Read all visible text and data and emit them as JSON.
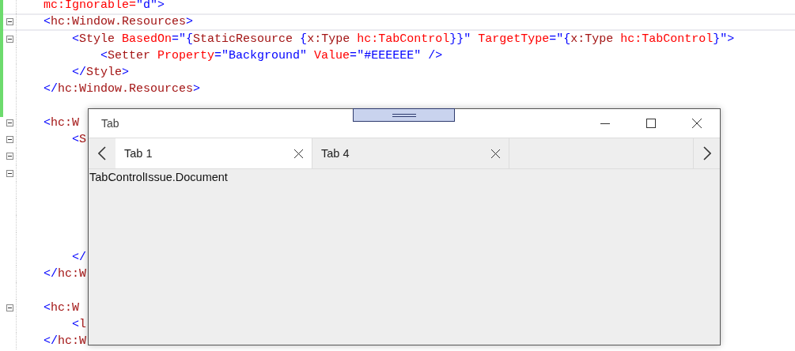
{
  "editor": {
    "lines": [
      {
        "collapsible": false,
        "kind": "outer",
        "tokens": [
          {
            "kind": "attribute",
            "text": "mc:Ignorable="
          },
          {
            "kind": "value",
            "text": "\"d\""
          },
          {
            "kind": "bracket",
            "text": ">"
          }
        ]
      },
      {
        "collapsible": true,
        "kind": "outer",
        "tokens": [
          {
            "kind": "bracket",
            "text": "<"
          },
          {
            "kind": "element",
            "text": "hc:Window.Resources"
          },
          {
            "kind": "bracket",
            "text": ">"
          }
        ]
      },
      {
        "collapsible": true,
        "kind": "inner",
        "tokens": [
          {
            "kind": "bracket",
            "text": "<"
          },
          {
            "kind": "element",
            "text": "Style"
          },
          {
            "kind": "attribute",
            "text": " BasedOn"
          },
          {
            "kind": "bracket",
            "text": "="
          },
          {
            "kind": "value",
            "text": "\"{"
          },
          {
            "kind": "element",
            "text": "StaticResource"
          },
          {
            "kind": "value",
            "text": " {"
          },
          {
            "kind": "element",
            "text": "x:Type"
          },
          {
            "kind": "attribute",
            "text": " hc:TabControl"
          },
          {
            "kind": "value",
            "text": "}}\""
          },
          {
            "kind": "attribute",
            "text": " TargetType"
          },
          {
            "kind": "bracket",
            "text": "="
          },
          {
            "kind": "value",
            "text": "\"{"
          },
          {
            "kind": "element",
            "text": "x:Type"
          },
          {
            "kind": "attribute",
            "text": " hc:TabControl"
          },
          {
            "kind": "value",
            "text": "}\""
          },
          {
            "kind": "bracket",
            "text": ">"
          }
        ]
      },
      {
        "collapsible": false,
        "kind": "deep",
        "tokens": [
          {
            "kind": "bracket",
            "text": "<"
          },
          {
            "kind": "element",
            "text": "Setter"
          },
          {
            "kind": "attribute",
            "text": " Property"
          },
          {
            "kind": "bracket",
            "text": "="
          },
          {
            "kind": "value",
            "text": "\"Background\""
          },
          {
            "kind": "attribute",
            "text": " Value"
          },
          {
            "kind": "bracket",
            "text": "="
          },
          {
            "kind": "value",
            "text": "\"#EEEEEE\" />"
          }
        ]
      },
      {
        "collapsible": false,
        "kind": "inner",
        "tokens": [
          {
            "kind": "bracket",
            "text": "</"
          },
          {
            "kind": "element",
            "text": "Style"
          },
          {
            "kind": "bracket",
            "text": ">"
          }
        ]
      },
      {
        "collapsible": false,
        "kind": "outer",
        "tokens": [
          {
            "kind": "bracket",
            "text": "</"
          },
          {
            "kind": "element",
            "text": "hc:Window.Resources"
          },
          {
            "kind": "bracket",
            "text": ">"
          }
        ]
      },
      {
        "collapsible": false,
        "kind": "outer"
      },
      {
        "collapsible": true,
        "kind": "outer",
        "tokens": [
          {
            "kind": "bracket",
            "text": "<"
          },
          {
            "kind": "element",
            "text": "hc:W"
          }
        ]
      },
      {
        "collapsible": true,
        "kind": "inner",
        "tokens": [
          {
            "kind": "bracket",
            "text": "<"
          },
          {
            "kind": "element",
            "text": "S"
          }
        ]
      },
      {
        "collapsible": true,
        "kind": "outer"
      },
      {
        "collapsible": true,
        "kind": "outer"
      },
      {
        "collapsible": false,
        "kind": "outer"
      },
      {
        "collapsible": false,
        "kind": "outer"
      },
      {
        "collapsible": false,
        "kind": "outer"
      },
      {
        "collapsible": false,
        "kind": "outer"
      },
      {
        "collapsible": false,
        "kind": "inner",
        "tokens": [
          {
            "kind": "bracket",
            "text": "</"
          }
        ]
      },
      {
        "collapsible": false,
        "kind": "outer",
        "tokens": [
          {
            "kind": "bracket",
            "text": "</"
          },
          {
            "kind": "element",
            "text": "hc:W"
          }
        ]
      },
      {
        "collapsible": false,
        "kind": "outer"
      },
      {
        "collapsible": true,
        "kind": "outer",
        "tokens": [
          {
            "kind": "bracket",
            "text": "<"
          },
          {
            "kind": "element",
            "text": "hc:W"
          }
        ]
      },
      {
        "collapsible": false,
        "kind": "inner",
        "tokens": [
          {
            "kind": "bracket",
            "text": "<"
          },
          {
            "kind": "element",
            "text": "l"
          }
        ]
      },
      {
        "collapsible": false,
        "kind": "outer",
        "tokens": [
          {
            "kind": "bracket",
            "text": "</"
          },
          {
            "kind": "element",
            "text": "hc:W"
          }
        ]
      }
    ]
  },
  "window": {
    "title": "Tab",
    "tabs": [
      {
        "label": "Tab 1",
        "selected": true
      },
      {
        "label": "Tab 4",
        "selected": false
      }
    ],
    "content": "TabControlIssue.Document"
  }
}
